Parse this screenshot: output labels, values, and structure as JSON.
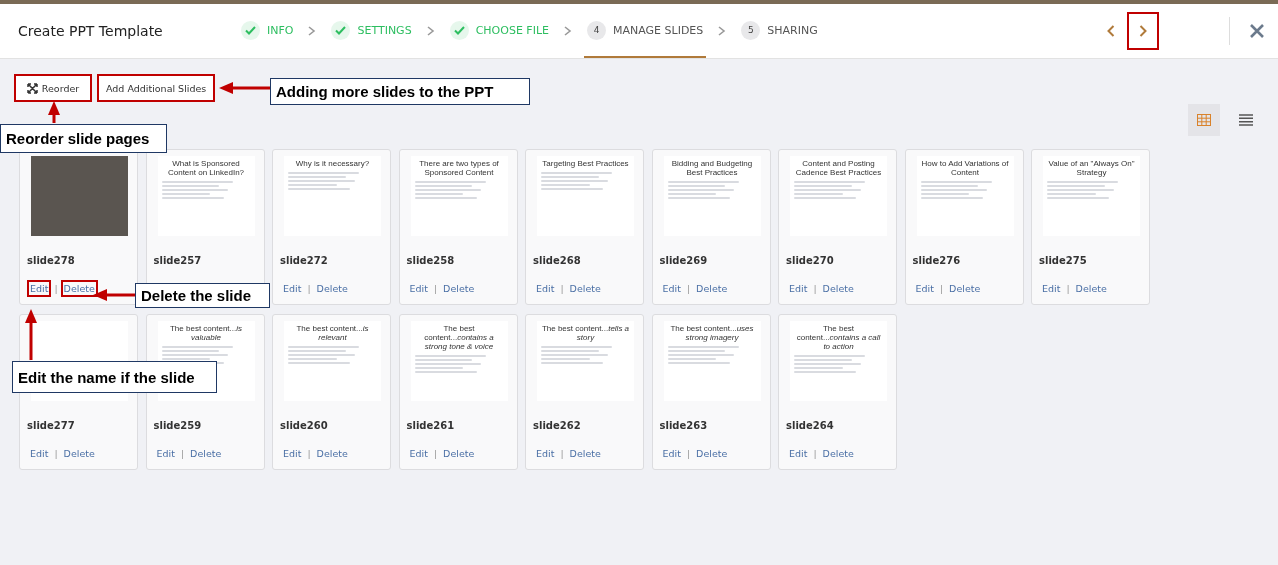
{
  "dialog": {
    "title": "Create PPT Template"
  },
  "steps": [
    {
      "label": "INFO",
      "kind": "done",
      "selected": false
    },
    {
      "label": "SETTINGS",
      "kind": "done",
      "selected": false
    },
    {
      "label": "CHOOSE FILE",
      "kind": "done",
      "selected": false
    },
    {
      "label": "MANAGE SLIDES",
      "kind": "numbered",
      "number": "4",
      "selected": true
    },
    {
      "label": "SHARING",
      "kind": "numbered",
      "number": "5",
      "selected": false
    }
  ],
  "nav": {
    "prev_highlighted": false,
    "next_highlighted": true
  },
  "toolbar": {
    "reorder": {
      "label": "Reorder",
      "highlighted": true
    },
    "add": {
      "label": "Add Additional Slides",
      "highlighted": true
    }
  },
  "views": [
    {
      "kind": "grid",
      "selected": true
    },
    {
      "kind": "list",
      "selected": false
    }
  ],
  "slides": [
    {
      "name": "slide278",
      "kind": "photo",
      "edit": "Edit",
      "separator": "|",
      "delete": "Delete",
      "edit_highlighted": true,
      "delete_highlighted": true
    },
    {
      "name": "slide257",
      "kind": "text",
      "title": "What is Sponsored Content on LinkedIn?"
    },
    {
      "name": "slide272",
      "kind": "text",
      "title": "Why is it necessary?",
      "edit": "Edit",
      "separator": "|",
      "delete": "Delete",
      "edit_highlighted": false,
      "delete_highlighted": false
    },
    {
      "name": "slide258",
      "kind": "text",
      "title": "There are two types of Sponsored Content",
      "edit": "Edit",
      "separator": "|",
      "delete": "Delete",
      "edit_highlighted": false,
      "delete_highlighted": false
    },
    {
      "name": "slide268",
      "kind": "text",
      "title": "Targeting Best Practices",
      "edit": "Edit",
      "separator": "|",
      "delete": "Delete",
      "edit_highlighted": false,
      "delete_highlighted": false
    },
    {
      "name": "slide269",
      "kind": "text",
      "title": "Bidding and Budgeting Best Practices",
      "edit": "Edit",
      "separator": "|",
      "delete": "Delete",
      "edit_highlighted": false,
      "delete_highlighted": false
    },
    {
      "name": "slide270",
      "kind": "text",
      "title": "Content and Posting Cadence Best Practices",
      "edit": "Edit",
      "separator": "|",
      "delete": "Delete",
      "edit_highlighted": false,
      "delete_highlighted": false
    },
    {
      "name": "slide276",
      "kind": "text",
      "title": "How to Add Variations of Content",
      "edit": "Edit",
      "separator": "|",
      "delete": "Delete",
      "edit_highlighted": false,
      "delete_highlighted": false
    },
    {
      "name": "slide275",
      "kind": "text",
      "title": "Value of an \"Always On\" Strategy",
      "edit": "Edit",
      "separator": "|",
      "delete": "Delete",
      "edit_highlighted": false,
      "delete_highlighted": false
    },
    {
      "name": "slide277",
      "kind": "blank",
      "edit": "Edit",
      "separator": "|",
      "delete": "Delete",
      "edit_highlighted": false,
      "delete_highlighted": false
    },
    {
      "name": "slide259",
      "kind": "text",
      "title": "The best content...*is valuable*",
      "edit": "Edit",
      "separator": "|",
      "delete": "Delete",
      "edit_highlighted": false,
      "delete_highlighted": false
    },
    {
      "name": "slide260",
      "kind": "text",
      "title": "The best content...*is relevant*",
      "edit": "Edit",
      "separator": "|",
      "delete": "Delete",
      "edit_highlighted": false,
      "delete_highlighted": false
    },
    {
      "name": "slide261",
      "kind": "text",
      "title": "The best content...*contains a strong tone & voice*",
      "edit": "Edit",
      "separator": "|",
      "delete": "Delete",
      "edit_highlighted": false,
      "delete_highlighted": false
    },
    {
      "name": "slide262",
      "kind": "text",
      "title": "The best content...*tells a story*",
      "edit": "Edit",
      "separator": "|",
      "delete": "Delete",
      "edit_highlighted": false,
      "delete_highlighted": false
    },
    {
      "name": "slide263",
      "kind": "text",
      "title": "The best content...*uses strong imagery*",
      "edit": "Edit",
      "separator": "|",
      "delete": "Delete",
      "edit_highlighted": false,
      "delete_highlighted": false
    },
    {
      "name": "slide264",
      "kind": "text",
      "title": "The best content...*contains a call to action*",
      "edit": "Edit",
      "separator": "|",
      "delete": "Delete",
      "edit_highlighted": false,
      "delete_highlighted": false
    }
  ],
  "annotations": [
    {
      "text": "Adding more slides to the PPT",
      "kind": "left"
    },
    {
      "text": "Reorder slide pages",
      "kind": "up"
    },
    {
      "text": "Delete the slide",
      "kind": "left"
    },
    {
      "text": "Edit the name if the slide",
      "kind": "up"
    }
  ]
}
